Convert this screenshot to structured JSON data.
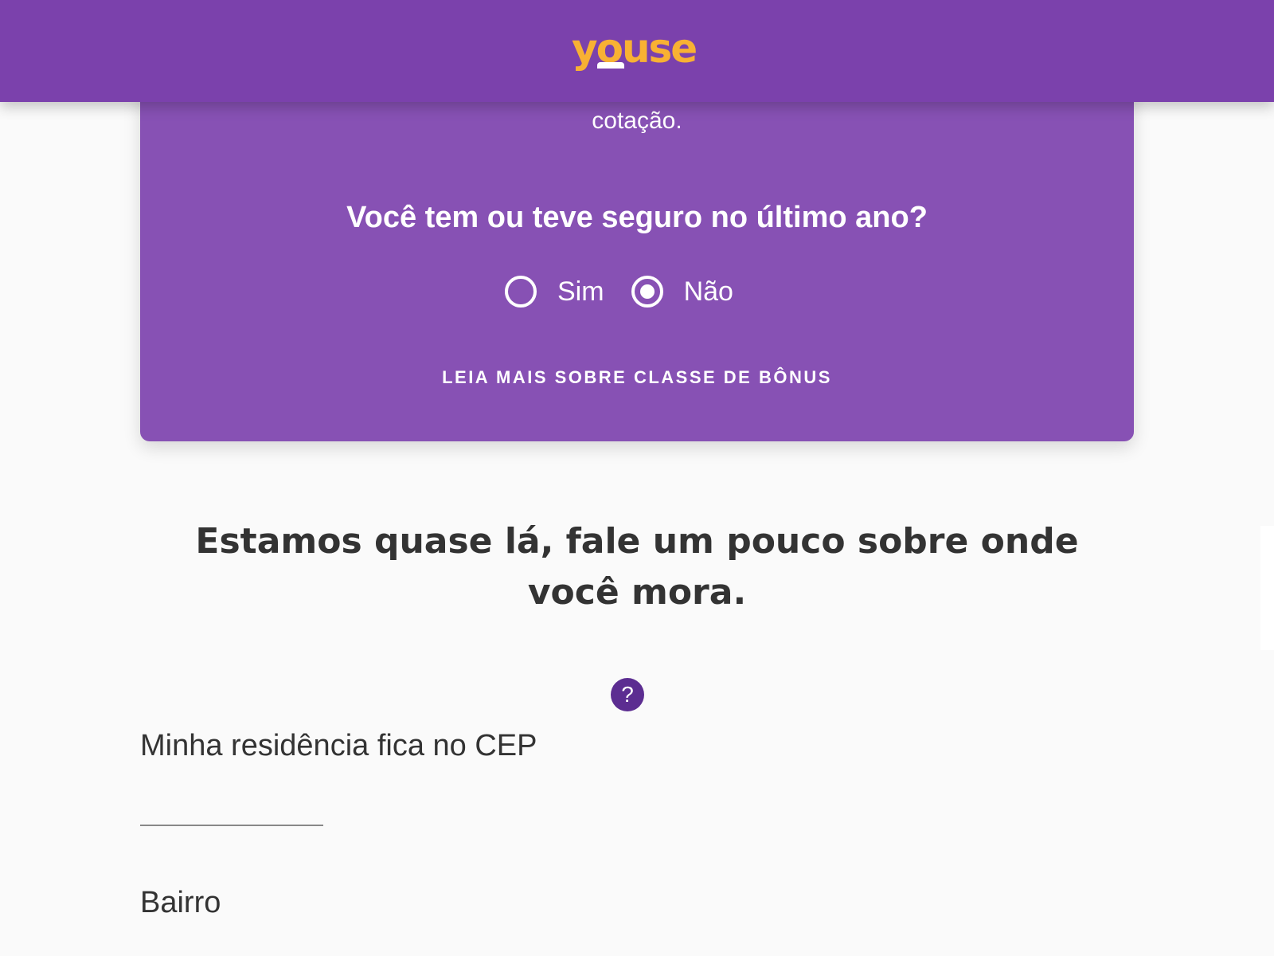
{
  "header": {
    "logo_text": "YOUSE",
    "brand_color": "#7b41ac",
    "logo_color": "#f8b133"
  },
  "card": {
    "intro_text": "cotação.",
    "question": "Você tem ou teve seguro no último ano?",
    "options": [
      {
        "label": "Sim",
        "checked": false
      },
      {
        "label": "Não",
        "checked": true
      }
    ],
    "bonus_link": "LEIA MAIS SOBRE CLASSE DE BÔNUS",
    "card_color": "#8751b4"
  },
  "main": {
    "heading": "Estamos quase lá, fale um pouco sobre onde você mora.",
    "help_icon": "question-icon",
    "help_glyph": "?",
    "cep_label": "Minha residência fica no CEP",
    "cep_value": "",
    "bairro_label": "Bairro"
  }
}
